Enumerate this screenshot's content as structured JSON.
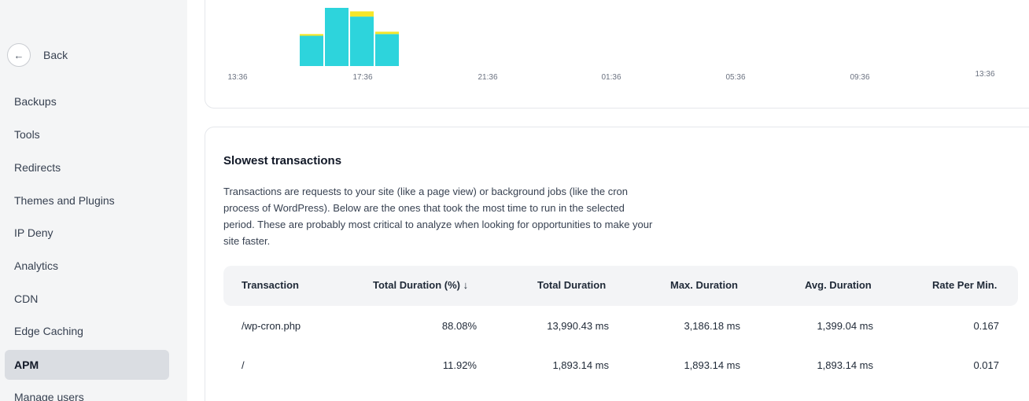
{
  "sidebar": {
    "back_label": "Back",
    "back_icon": "arrow-left-icon",
    "items": [
      {
        "label": "Backups"
      },
      {
        "label": "Tools"
      },
      {
        "label": "Redirects"
      },
      {
        "label": "Themes and Plugins"
      },
      {
        "label": "IP Deny"
      },
      {
        "label": "Analytics"
      },
      {
        "label": "CDN"
      },
      {
        "label": "Edge Caching"
      },
      {
        "label": "APM",
        "active": true
      },
      {
        "label": "Manage users"
      }
    ]
  },
  "chart_data": {
    "type": "bar",
    "stacked": true,
    "x_tick_labels": [
      "13:36",
      "17:36",
      "21:36",
      "01:36",
      "05:36",
      "09:36",
      "13:36"
    ],
    "series_colors": [
      "#2dd4dc",
      "#f5e62a"
    ],
    "bars": [
      {
        "lower": 0.52,
        "upper": 0.03
      },
      {
        "lower": 1.0,
        "upper": 0.0
      },
      {
        "lower": 0.85,
        "upper": 0.09
      },
      {
        "lower": 0.55,
        "upper": 0.04
      }
    ]
  },
  "transactions": {
    "title": "Slowest transactions",
    "description": "Transactions are requests to your site (like a page view) or background jobs (like the cron process of WordPress). Below are the ones that took the most time to run in the selected period. These are probably most critical to analyze when looking for opportunities to make your site faster.",
    "columns": [
      "Transaction",
      "Total Duration (%) ↓",
      "Total Duration",
      "Max. Duration",
      "Avg. Duration",
      "Rate Per Min."
    ],
    "rows": [
      [
        "/wp-cron.php",
        "88.08%",
        "13,990.43 ms",
        "3,186.18 ms",
        "1,399.04 ms",
        "0.167"
      ],
      [
        "/",
        "11.92%",
        "1,893.14 ms",
        "1,893.14 ms",
        "1,893.14 ms",
        "0.017"
      ]
    ]
  }
}
